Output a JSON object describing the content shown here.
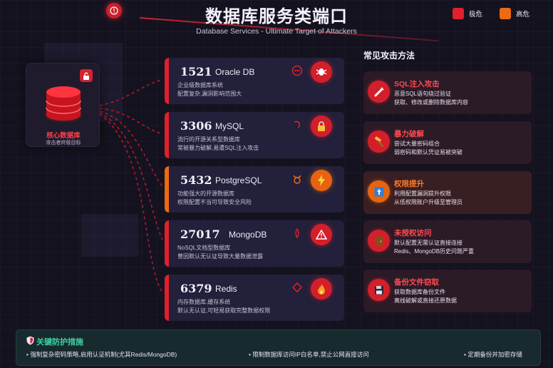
{
  "header": {
    "title": "数据库服务类端口",
    "subtitle": "Database Services - Ultimate Target of Attackers"
  },
  "legend": [
    {
      "label": "极危",
      "color": "#e0202c"
    },
    {
      "label": "高危",
      "color": "#ec6a12"
    }
  ],
  "core": {
    "label": "核心数据库",
    "sub": "攻击者终极目标"
  },
  "ports": [
    {
      "port": "1521",
      "name": "Oracle DB",
      "desc1": "企业级数据库系统",
      "desc2": "配置复杂,漏洞影响范围大",
      "level": "critical",
      "icon": "bug-icon",
      "small_icon": "minus-circle-icon"
    },
    {
      "port": "3306",
      "name": "MySQL",
      "desc1": "流行的开源关系型数据库",
      "desc2": "常被暴力破解,易遭SQL注入攻击",
      "level": "critical",
      "icon": "lock-icon",
      "small_icon": "dolphin-icon"
    },
    {
      "port": "5432",
      "name": "PostgreSQL",
      "desc1": "功能强大的开源数据库",
      "desc2": "权限配置不当可导致安全风险",
      "level": "high",
      "icon": "bolt-icon",
      "small_icon": "elephant-icon"
    },
    {
      "port": "27017",
      "name": "MongoDB",
      "desc1": "NoSQL文档型数据库",
      "desc2": "曾因默认无认证导致大量数据泄露",
      "level": "critical",
      "icon": "warning-icon",
      "small_icon": "leaf-icon"
    },
    {
      "port": "6379",
      "name": "Redis",
      "desc1": "内存数据库,缓存系统",
      "desc2": "默认无认证,可轻易获取完整数据权限",
      "level": "critical",
      "icon": "fire-icon",
      "small_icon": "diamond-icon"
    }
  ],
  "attacks": {
    "title": "常见攻击方法",
    "items": [
      {
        "name": "SQL注入攻击",
        "desc1": "恶意SQL语句绕过验证",
        "desc2": "获取、修改或删除数据库内容",
        "icon": "syringe-icon",
        "level": "critical"
      },
      {
        "name": "暴力破解",
        "desc1": "尝试大量密码组合",
        "desc2": "弱密码和默认凭证易被突破",
        "icon": "hammer-icon",
        "level": "critical"
      },
      {
        "name": "权限提升",
        "desc1": "利用配置漏洞提升权限",
        "desc2": "从低权限账户升级至管理员",
        "icon": "arrow-up-icon",
        "level": "high"
      },
      {
        "name": "未授权访问",
        "desc1": "默认配置无需认证直接连接",
        "desc2": "Redis、MongoDB历史问题严重",
        "icon": "door-icon",
        "level": "critical"
      },
      {
        "name": "备份文件窃取",
        "desc1": "获取数据库备份文件",
        "desc2": "离线破解或直接还原数据",
        "icon": "floppy-disk-icon",
        "level": "critical"
      }
    ]
  },
  "defense": {
    "title": "关键防护措施",
    "items": [
      "• 强制复杂密码策略,启用认证机制(尤其Redis/MongoDB)",
      "• 限制数据库访问IP白名单,禁止公网直接访问",
      "• 定期备份并加密存储"
    ]
  },
  "colors": {
    "critical": "#e0202c",
    "high": "#ec6a12",
    "accent_green": "#3fd3a2"
  }
}
